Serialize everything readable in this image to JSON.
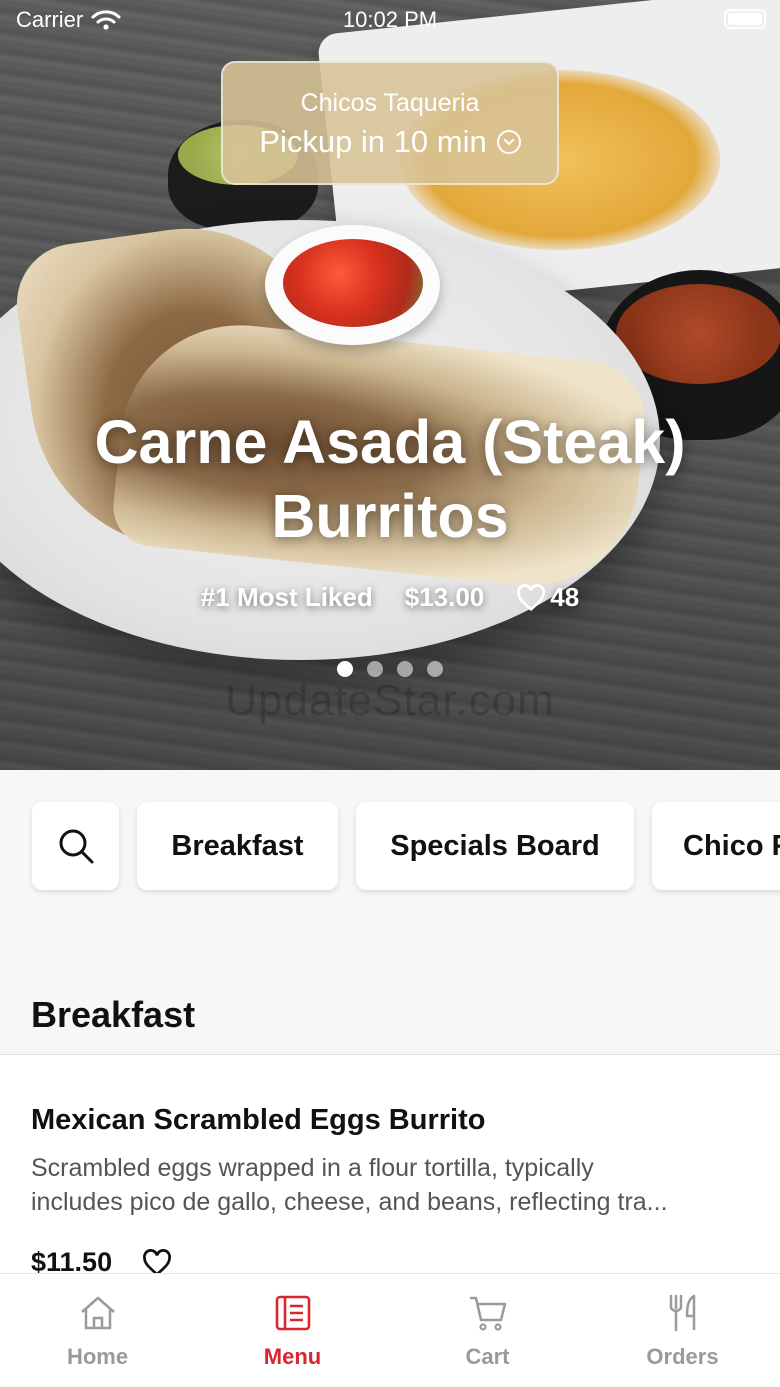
{
  "status_bar": {
    "carrier": "Carrier",
    "time": "10:02 PM"
  },
  "restaurant": {
    "name": "Chicos Taqueria",
    "pickup": "Pickup in 10 min"
  },
  "featured": {
    "title": "Carne Asada (Steak) Burritos",
    "rank": "#1 Most Liked",
    "price": "$13.00",
    "likes": "48",
    "slide_count": 4,
    "active_slide": 1
  },
  "watermark": "UpdateStar.com",
  "categories": [
    "Breakfast",
    "Specials Board",
    "Chico Favorites"
  ],
  "section": {
    "title": "Breakfast",
    "items": [
      {
        "name": "Mexican Scrambled Eggs Burrito",
        "desc_line1": "Scrambled eggs wrapped in a flour tortilla, typically",
        "desc_line2": "includes pico de gallo, cheese, and beans, reflecting tra...",
        "price": "$11.50"
      }
    ]
  },
  "tabs": {
    "home": "Home",
    "menu": "Menu",
    "cart": "Cart",
    "orders": "Orders",
    "active": "Menu"
  },
  "colors": {
    "accent": "#d7262d",
    "inactive": "#9a9a9a",
    "pill": "#d7c396"
  }
}
